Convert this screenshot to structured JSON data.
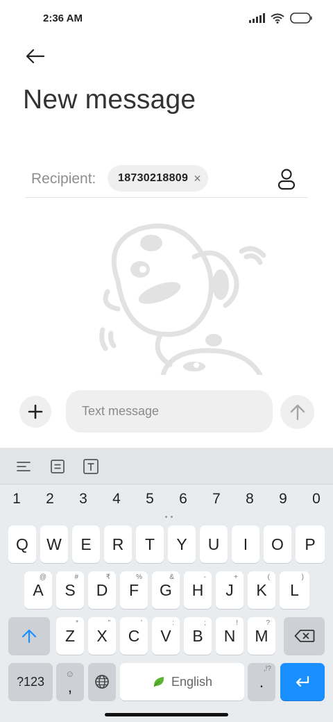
{
  "status_bar": {
    "time": "2:36 AM",
    "signal_icon": "cellular-signal-icon",
    "wifi_icon": "wifi-icon",
    "battery_icon": "battery-icon"
  },
  "header": {
    "back_icon": "back-arrow-icon",
    "title": "New message"
  },
  "recipient": {
    "label": "Recipient:",
    "chip_value": "18730218809",
    "chip_remove_symbol": "×",
    "contacts_icon": "contact-person-icon"
  },
  "compose": {
    "add_icon": "plus-icon",
    "placeholder": "Text message",
    "value": "",
    "send_icon": "send-arrow-up-icon"
  },
  "keyboard": {
    "toolbar": [
      "align-left-icon",
      "clipboard-icon",
      "text-format-icon"
    ],
    "numbers": [
      "1",
      "2",
      "3",
      "4",
      "5",
      "6",
      "7",
      "8",
      "9",
      "0"
    ],
    "row1": [
      {
        "label": "Q",
        "hint": ""
      },
      {
        "label": "W",
        "hint": ""
      },
      {
        "label": "E",
        "hint": ""
      },
      {
        "label": "R",
        "hint": ""
      },
      {
        "label": "T",
        "hint": ""
      },
      {
        "label": "Y",
        "hint": ""
      },
      {
        "label": "U",
        "hint": ""
      },
      {
        "label": "I",
        "hint": ""
      },
      {
        "label": "O",
        "hint": ""
      },
      {
        "label": "P",
        "hint": ""
      }
    ],
    "row2": [
      {
        "label": "A",
        "hint": "@"
      },
      {
        "label": "S",
        "hint": "#"
      },
      {
        "label": "D",
        "hint": "₹"
      },
      {
        "label": "F",
        "hint": "%"
      },
      {
        "label": "G",
        "hint": "&"
      },
      {
        "label": "H",
        "hint": "-"
      },
      {
        "label": "J",
        "hint": "+"
      },
      {
        "label": "K",
        "hint": "("
      },
      {
        "label": "L",
        "hint": ")"
      }
    ],
    "row3": [
      {
        "label": "Z",
        "hint": "*"
      },
      {
        "label": "X",
        "hint": "\""
      },
      {
        "label": "C",
        "hint": "'"
      },
      {
        "label": "V",
        "hint": ":"
      },
      {
        "label": "B",
        "hint": ";"
      },
      {
        "label": "N",
        "hint": "!"
      },
      {
        "label": "M",
        "hint": "?"
      }
    ],
    "shift_icon": "shift-arrow-icon",
    "backspace_icon": "backspace-icon",
    "symbols_label": "?123",
    "comma_label": ",",
    "emoji_icon": "emoji-icon",
    "globe_icon": "globe-icon",
    "space_label": "English",
    "space_icon": "leaf-icon",
    "period_label": ".",
    "period_hint": ",!?",
    "enter_icon": "enter-return-icon",
    "accent_color": "#1a8fff"
  }
}
